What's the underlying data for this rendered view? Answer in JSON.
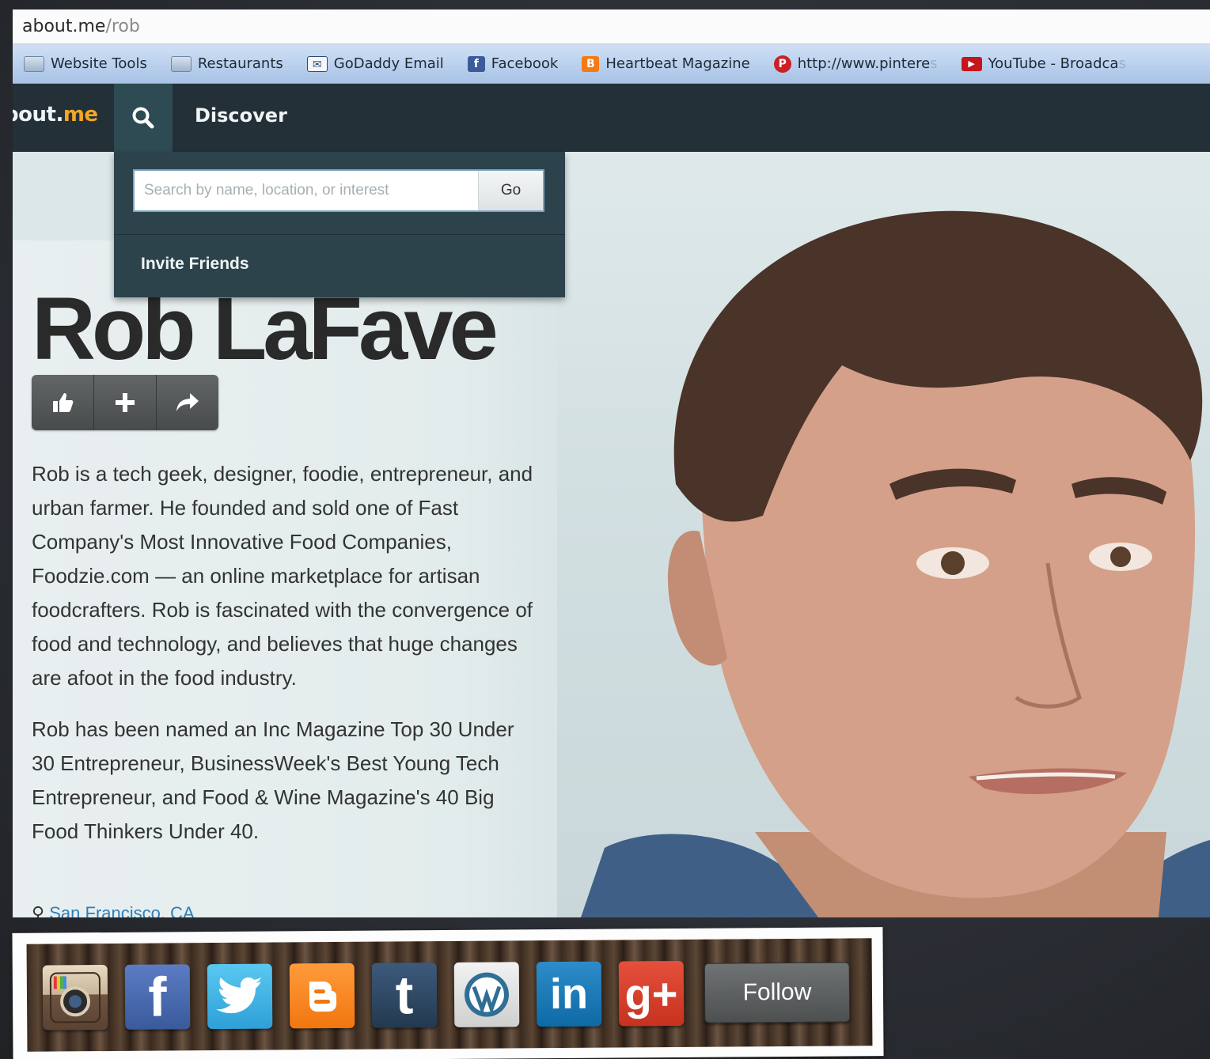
{
  "browser": {
    "url_host": "about.me",
    "url_path": "/rob",
    "bookmarks": [
      {
        "label": "Website Tools",
        "icon": "folder-icon"
      },
      {
        "label": "Restaurants",
        "icon": "folder-icon"
      },
      {
        "label": "GoDaddy Email",
        "icon": "mail-icon"
      },
      {
        "label": "Facebook",
        "icon": "facebook-icon"
      },
      {
        "label": "Heartbeat Magazine",
        "icon": "blogger-icon"
      },
      {
        "label": "http://www.pintere",
        "fade": "s",
        "icon": "pinterest-icon"
      },
      {
        "label": "YouTube - Broadca",
        "fade": "s",
        "icon": "youtube-icon"
      }
    ]
  },
  "nav": {
    "logo_main": "out.",
    "logo_partial": "ab",
    "logo_accent": "me",
    "discover_label": "Discover"
  },
  "search": {
    "placeholder": "Search by name, location, or interest",
    "value": "",
    "go_label": "Go",
    "invite_label": "Invite Friends"
  },
  "profile": {
    "name": "Rob LaFave",
    "bio_paragraphs": [
      "Rob is a tech geek, designer, foodie, entrepreneur, and urban farmer. He founded and sold one of Fast Company's Most Innovative Food Companies, Foodzie.com — an online marketplace for artisan foodcrafters. Rob is fascinated with the convergence of food and technology, and believes that huge changes are afoot in the food industry.",
      "Rob has been named an Inc Magazine Top 30 Under 30 Entrepreneur, BusinessWeek's Best Young Tech Entrepreneur, and Food & Wine Magazine's 40 Big Food Thinkers Under 40."
    ],
    "location": "San Francisco, CA"
  },
  "social": {
    "icons": [
      {
        "name": "instagram-icon",
        "glyph": ""
      },
      {
        "name": "facebook-icon",
        "glyph": "f"
      },
      {
        "name": "twitter-icon",
        "glyph": ""
      },
      {
        "name": "blogger-icon",
        "glyph": ""
      },
      {
        "name": "tumblr-icon",
        "glyph": "t"
      },
      {
        "name": "wordpress-icon",
        "glyph": ""
      },
      {
        "name": "linkedin-icon",
        "glyph": "in"
      },
      {
        "name": "google-plus-icon",
        "glyph": "g+"
      }
    ],
    "follow_label": "Follow"
  },
  "colors": {
    "nav_bg": "#233038",
    "accent": "#f5a623",
    "dropdown_bg": "#2c434c"
  }
}
